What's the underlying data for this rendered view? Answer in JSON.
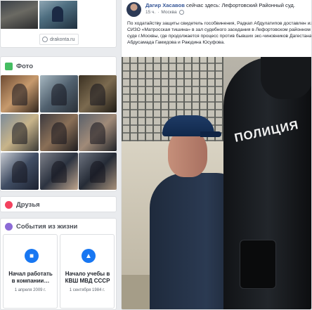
{
  "left": {
    "link_text": "drakonta.ru",
    "photos_title": "Фото",
    "friends_title": "Друзья",
    "events_title": "События из жизни",
    "events": [
      {
        "title": "Начал работать в компании…",
        "date": "1 апреля 2009 г."
      },
      {
        "title": "Начало учебы в КВШ МВД СССР",
        "date": "1 сентября 1984 г."
      }
    ]
  },
  "post": {
    "author": "Дагир Хасавов",
    "action": "сейчас здесь: Лефортовский Районный суд.",
    "time": "15 ч.",
    "location": "Москва",
    "text": "По ходатайству защиты свидетель гособвинения, Радкап Абдулатипов доставлен из СИЗО «Матросская тишина» в зал судебного заседания в Лефортовском районном суде г.Москвы, где продолжается процесс против бывших экс-чиновников Дагестана Абдусамада Гамидова и Раюдина Юсуфова.",
    "photo_label": "ПОЛИЦИЯ"
  },
  "colors": {
    "brand": "#1877f2",
    "photo_icon": "#45bd62",
    "friends_icon": "#f3425f",
    "events_icon": "#8c6bd6"
  }
}
